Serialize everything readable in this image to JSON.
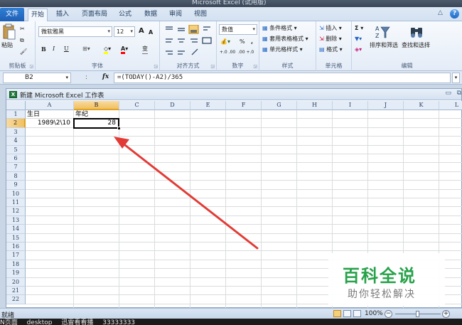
{
  "window": {
    "title": "Microsoft Excel (试用版)"
  },
  "ribbon_tabs": [
    "文件",
    "开始",
    "插入",
    "页面布局",
    "公式",
    "数据",
    "审阅",
    "视图"
  ],
  "active_tab": "开始",
  "clipboard": {
    "paste_label": "粘贴",
    "group_label": "剪贴板"
  },
  "font": {
    "name": "微软雅黑",
    "size": "12",
    "bold": "B",
    "italic": "I",
    "underline": "U",
    "group_label": "字体",
    "grow": "A",
    "shrink": "A",
    "wen": "变"
  },
  "alignment": {
    "group_label": "对齐方式"
  },
  "number": {
    "format": "数值",
    "percent": "%",
    "comma": ",",
    "inc_dec": "+.0 .00",
    "dec_dec": ".00 +.0",
    "group_label": "数字"
  },
  "styles": {
    "conditional": "条件格式",
    "table": "套用表格格式",
    "cell_styles": "单元格样式",
    "group_label": "样式"
  },
  "cells": {
    "insert": "插入",
    "delete": "删除",
    "format": "格式",
    "group_label": "单元格"
  },
  "editing": {
    "sigma": "Σ",
    "sort_filter": "排序和筛选",
    "find_select": "查找和选择",
    "group_label": "编辑"
  },
  "formula_bar": {
    "name_box": "B2",
    "fx": "fx",
    "formula": "=(TODAY()-A2)/365"
  },
  "workbook": {
    "title": "新建 Microsoft Excel 工作表",
    "icon": "excel-icon"
  },
  "grid": {
    "columns": [
      "A",
      "B",
      "C",
      "D",
      "E",
      "F",
      "G",
      "H",
      "I",
      "J",
      "K",
      "L"
    ],
    "rows": [
      "1",
      "2",
      "3",
      "4",
      "5",
      "6",
      "7",
      "8",
      "9",
      "10",
      "11",
      "12",
      "13",
      "14",
      "15",
      "16",
      "17",
      "18",
      "19",
      "20",
      "21",
      "22"
    ],
    "selected_cell": "B2",
    "cell_values": {
      "A1": "生日",
      "B1": "年纪",
      "A2": "1989\\2\\10",
      "B2": "28"
    }
  },
  "status": {
    "mode": "就绪",
    "zoom": "100%"
  },
  "taskbar": {
    "text": "N页面    desktop    迅雷看看播    33333333"
  },
  "watermark": {
    "title": "百科全说",
    "subtitle": "助你轻松解决"
  },
  "annotation": {
    "arrow_color": "#e23b35"
  }
}
